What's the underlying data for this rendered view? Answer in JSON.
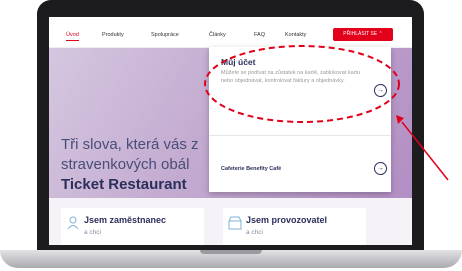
{
  "nav": {
    "items": [
      {
        "label": "Úvod"
      },
      {
        "label": "Produkty"
      },
      {
        "label": "Spolupráce"
      },
      {
        "label": "Články"
      },
      {
        "label": "FAQ"
      },
      {
        "label": "Kontakty"
      }
    ],
    "login_label": "PŘIHLÁSIT SE",
    "login_icon": "chevron-up-icon"
  },
  "hero": {
    "line1": "Tři slova, která vás z",
    "line2": "stravenkových obál",
    "line3": "Ticket Restaurant"
  },
  "dropdown": {
    "account_title": "Můj účet",
    "account_desc": "Můžete se podívat na zůstatek na kartě, zablokovat kartu nebo objednávat, kontrolovat faktury a objednávky.",
    "item2_label": "Cafeterie Benefity Café",
    "arrow_glyph": "→"
  },
  "cards": [
    {
      "title": "Jsem zaměstnanec",
      "sub": "a chci"
    },
    {
      "title": "Jsem provozovatel",
      "sub": "a chci"
    }
  ],
  "colors": {
    "brand_red": "#e2001a",
    "navy": "#2c2f5c",
    "highlight": "#e2001a"
  }
}
